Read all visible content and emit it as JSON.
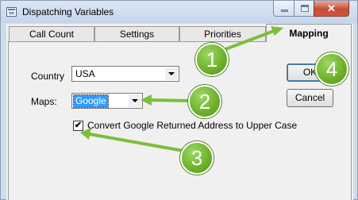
{
  "window": {
    "title": "Dispatching Variables",
    "controls": {
      "close_glyph": "✕"
    }
  },
  "tabs": [
    {
      "label": "Call Count",
      "active": false
    },
    {
      "label": "Settings",
      "active": false
    },
    {
      "label": "Priorities",
      "active": false
    },
    {
      "label": "Mapping",
      "active": true
    }
  ],
  "form": {
    "country": {
      "label": "Country",
      "value": "USA"
    },
    "maps": {
      "label": "Maps:",
      "value": "Google"
    },
    "convert_upper": {
      "label": "Convert Google Returned Address to Upper Case",
      "checked": true,
      "mark": "✔"
    }
  },
  "buttons": {
    "ok": "OK",
    "cancel": "Cancel"
  },
  "callouts": [
    "1",
    "2",
    "3",
    "4"
  ],
  "colors": {
    "callout_green": "#6fb32b",
    "arrow_green": "#7bbf3a",
    "selection_blue": "#3399ff",
    "close_red": "#c75037"
  }
}
